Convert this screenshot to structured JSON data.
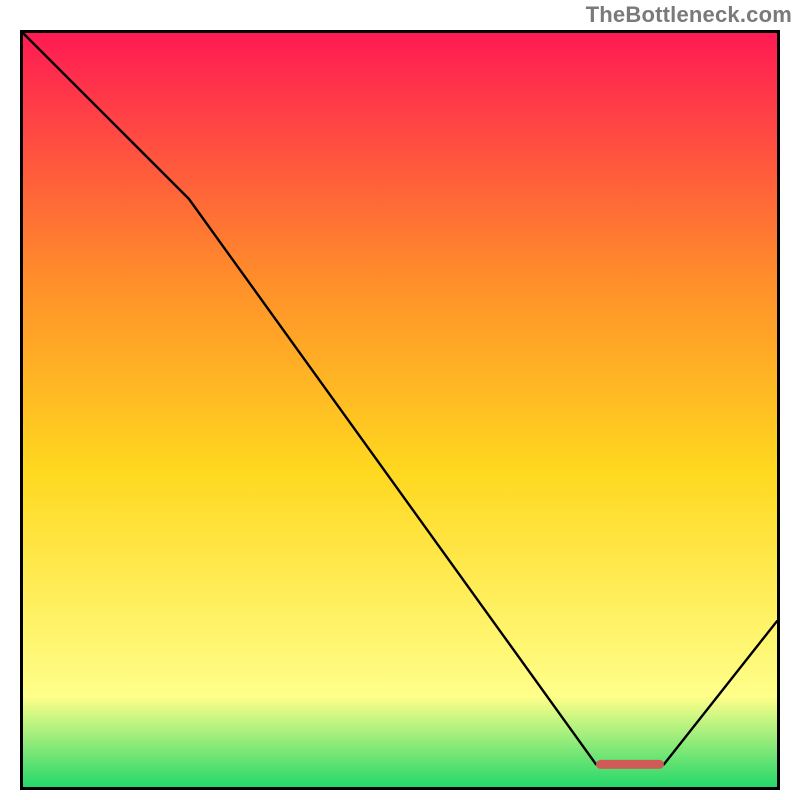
{
  "watermark": "TheBottleneck.com",
  "colors": {
    "gradient_top": "#ff1a53",
    "gradient_upper_mid": "#ff8f2a",
    "gradient_mid": "#ffd81f",
    "gradient_low": "#ffff8a",
    "gradient_bottom": "#24d86a",
    "curve": "#000000",
    "marker": "#cf5b58",
    "border": "#000000"
  },
  "chart_data": {
    "type": "line",
    "title": "",
    "xlabel": "",
    "ylabel": "",
    "xlim": [
      0,
      100
    ],
    "ylim": [
      0,
      100
    ],
    "grid": false,
    "legend": false,
    "series": [
      {
        "name": "bottleneck-curve",
        "x": [
          0,
          22,
          76,
          85,
          100
        ],
        "y": [
          100,
          78,
          3,
          3,
          22
        ]
      }
    ],
    "flat_region": {
      "x_start": 76,
      "x_end": 85,
      "y": 3
    }
  }
}
